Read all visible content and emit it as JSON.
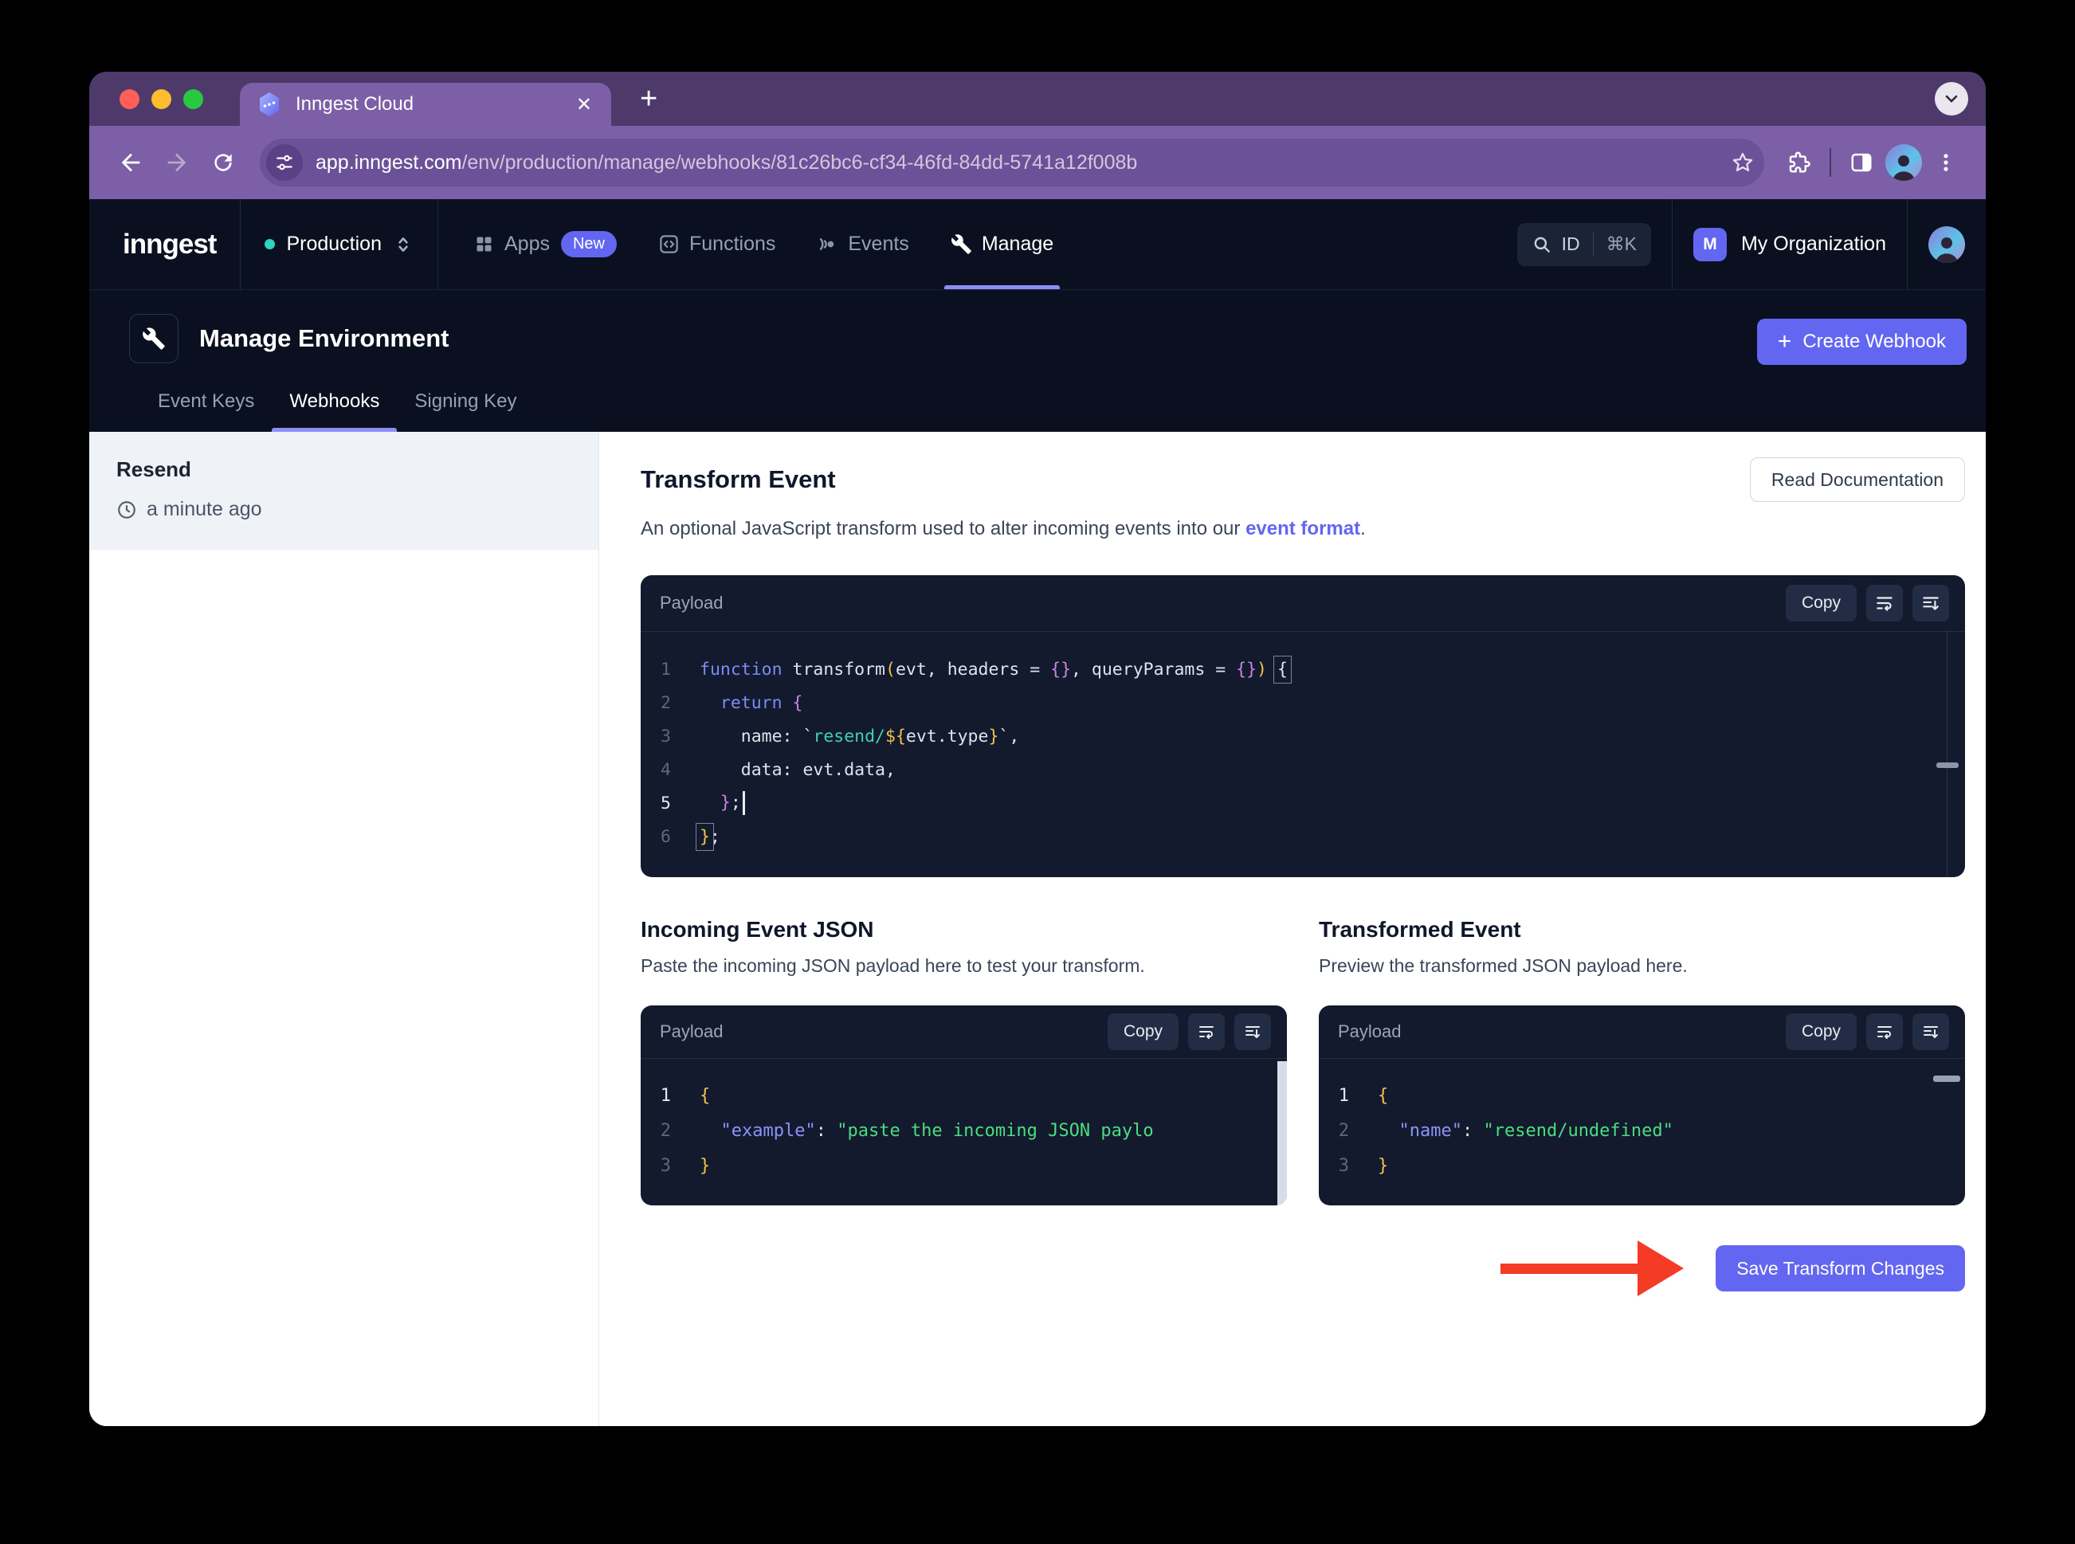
{
  "theme": {
    "accent": "#6366f1",
    "accent_underline": "#8b8ff5",
    "frame_purple": "#4d3a6b",
    "toolbar_purple": "#7c5fa6",
    "urlbar_purple": "#6b5197",
    "app_bg": "#0a101f",
    "editor_bg": "#131a2d",
    "arrow_red": "#f43b26",
    "env_dot": "#2dd4bf",
    "string_green": "#4ade80",
    "key_indigo": "#8b93f8",
    "keyword_indigo": "#7e8bf5",
    "brace_purple": "#c586e0",
    "paren_yellow": "#f2c14e",
    "teal": "#3fd0b6",
    "traffic_close": "#ff5f57",
    "traffic_min": "#febc2e",
    "traffic_zoom": "#28c840"
  },
  "browser": {
    "tab_title": "Inngest Cloud",
    "close_glyph": "✕",
    "new_tab_glyph": "+",
    "url_host": "app.inngest.com",
    "url_path": "/env/production/manage/webhooks/81c26bc6-cf34-46fd-84dd-5741a12f008b"
  },
  "nav": {
    "logo": "inngest",
    "environment": "Production",
    "items": [
      {
        "label": "Apps",
        "badge": "New"
      },
      {
        "label": "Functions"
      },
      {
        "label": "Events"
      },
      {
        "label": "Manage"
      }
    ],
    "search_id": "ID",
    "search_shortcut": "⌘K",
    "org_initial": "M",
    "org_name": "My Organization"
  },
  "page": {
    "title": "Manage Environment",
    "create_plus": "+",
    "create_webhook": "Create Webhook",
    "tabs": [
      {
        "label": "Event Keys"
      },
      {
        "label": "Webhooks"
      },
      {
        "label": "Signing Key"
      }
    ]
  },
  "sidebar": {
    "webhook_name": "Resend",
    "webhook_time": "a minute ago"
  },
  "main": {
    "title": "Transform Event",
    "desc_prefix": "An optional JavaScript transform used to alter incoming events into our ",
    "desc_link": "event format",
    "desc_suffix": ".",
    "read_docs": "Read Documentation",
    "incoming_title": "Incoming Event JSON",
    "incoming_desc": "Paste the incoming JSON payload here to test your transform.",
    "transformed_title": "Transformed Event",
    "transformed_desc": "Preview the transformed JSON payload here.",
    "save_button": "Save Transform Changes"
  },
  "editor_chrome": {
    "label": "Payload",
    "copy": "Copy"
  },
  "editors": {
    "transform": {
      "lines": [
        {
          "n": "1",
          "tokens": [
            {
              "c": "kw",
              "t": "function"
            },
            {
              "c": "pl",
              "t": " transform"
            },
            {
              "c": "y",
              "t": "("
            },
            {
              "c": "pl",
              "t": "evt, headers = "
            },
            {
              "c": "br",
              "t": "{}"
            },
            {
              "c": "pl",
              "t": ", queryParams = "
            },
            {
              "c": "br",
              "t": "{}"
            },
            {
              "c": "y",
              "t": ")"
            },
            {
              "c": "pl",
              "t": " "
            },
            {
              "c": "box",
              "t": "{"
            }
          ]
        },
        {
          "n": "2",
          "tokens": [
            {
              "c": "pl",
              "t": "  "
            },
            {
              "c": "kw",
              "t": "return"
            },
            {
              "c": "pl",
              "t": " "
            },
            {
              "c": "br",
              "t": "{"
            }
          ]
        },
        {
          "n": "3",
          "tokens": [
            {
              "c": "pl",
              "t": "    name: `"
            },
            {
              "c": "teal",
              "t": "resend/"
            },
            {
              "c": "y",
              "t": "${"
            },
            {
              "c": "pl",
              "t": "evt.type"
            },
            {
              "c": "y",
              "t": "}"
            },
            {
              "c": "pl",
              "t": "`,"
            }
          ]
        },
        {
          "n": "4",
          "tokens": [
            {
              "c": "pl",
              "t": "    data: evt.data,"
            }
          ]
        },
        {
          "n": "5",
          "active": true,
          "tokens": [
            {
              "c": "pl",
              "t": "  "
            },
            {
              "c": "br",
              "t": "}"
            },
            {
              "c": "pl",
              "t": ";"
            },
            {
              "c": "caret",
              "t": ""
            }
          ]
        },
        {
          "n": "6",
          "tokens": [
            {
              "c": "boxy",
              "t": "}"
            },
            {
              "c": "pl",
              "t": ";"
            }
          ]
        }
      ]
    },
    "incoming": {
      "lines": [
        {
          "n": "1",
          "active": true,
          "tokens": [
            {
              "c": "y",
              "t": "{"
            }
          ]
        },
        {
          "n": "2",
          "tokens": [
            {
              "c": "pl",
              "t": "  "
            },
            {
              "c": "key",
              "t": "\"example\""
            },
            {
              "c": "pl",
              "t": ": "
            },
            {
              "c": "str",
              "t": "\"paste the incoming JSON paylo"
            }
          ]
        },
        {
          "n": "3",
          "tokens": [
            {
              "c": "y",
              "t": "}"
            }
          ]
        }
      ]
    },
    "transformed": {
      "lines": [
        {
          "n": "1",
          "active": true,
          "tokens": [
            {
              "c": "y",
              "t": "{"
            }
          ]
        },
        {
          "n": "2",
          "tokens": [
            {
              "c": "pl",
              "t": "  "
            },
            {
              "c": "key",
              "t": "\"name\""
            },
            {
              "c": "pl",
              "t": ": "
            },
            {
              "c": "str",
              "t": "\"resend/undefined\""
            }
          ]
        },
        {
          "n": "3",
          "tokens": [
            {
              "c": "y",
              "t": "}"
            }
          ]
        }
      ]
    }
  }
}
